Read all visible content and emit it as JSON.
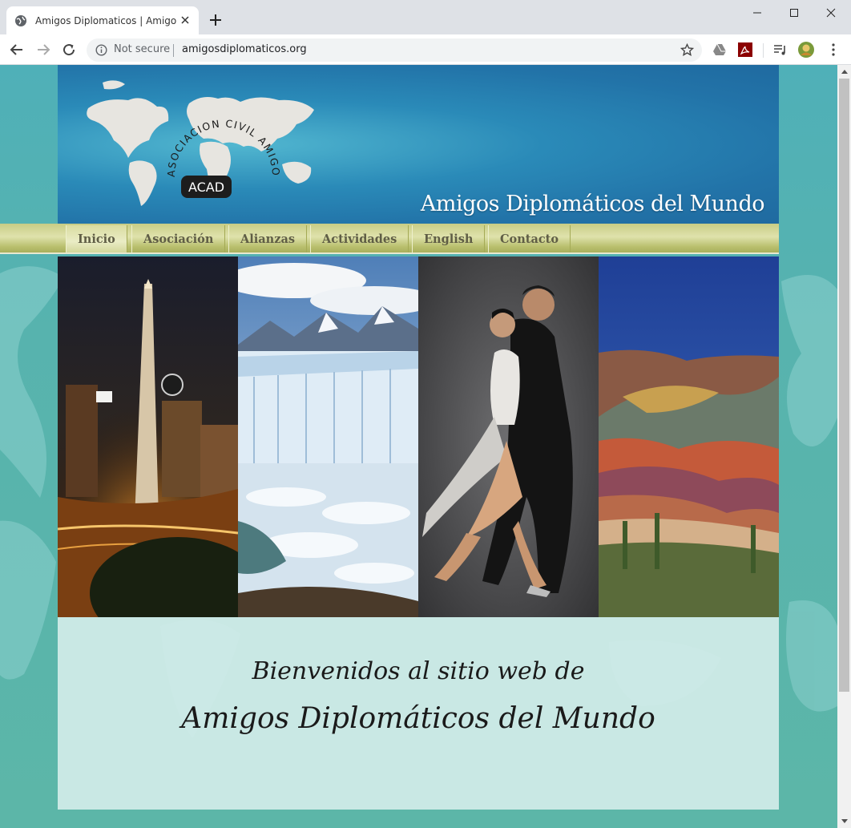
{
  "browser": {
    "tab_title": "Amigos Diplomaticos | Amigos Diplomaticos",
    "security_label": "Not secure",
    "url": "amigosdiplomaticos.org"
  },
  "header": {
    "logo_arc_text": "ASOCIACION CIVIL AMIGOS DIPLOMATICOS",
    "logo_badge": "ACAD",
    "site_title": "Amigos Diplomáticos del Mundo"
  },
  "nav": {
    "items": [
      {
        "label": "Inicio",
        "active": true
      },
      {
        "label": "Asociación"
      },
      {
        "label": "Alianzas"
      },
      {
        "label": "Actividades"
      },
      {
        "label": "English"
      },
      {
        "label": "Contacto"
      }
    ]
  },
  "welcome": {
    "line1": "Bienvenidos al sitio web de",
    "line2": "Amigos Diplomáticos del Mundo"
  },
  "colors": {
    "page_bg": "#5cb6a8",
    "header_blue": "#2273a8",
    "nav_olive": "#c7cc85",
    "nav_text": "#5f5d45",
    "welcome_bg": "#d2ece8"
  }
}
